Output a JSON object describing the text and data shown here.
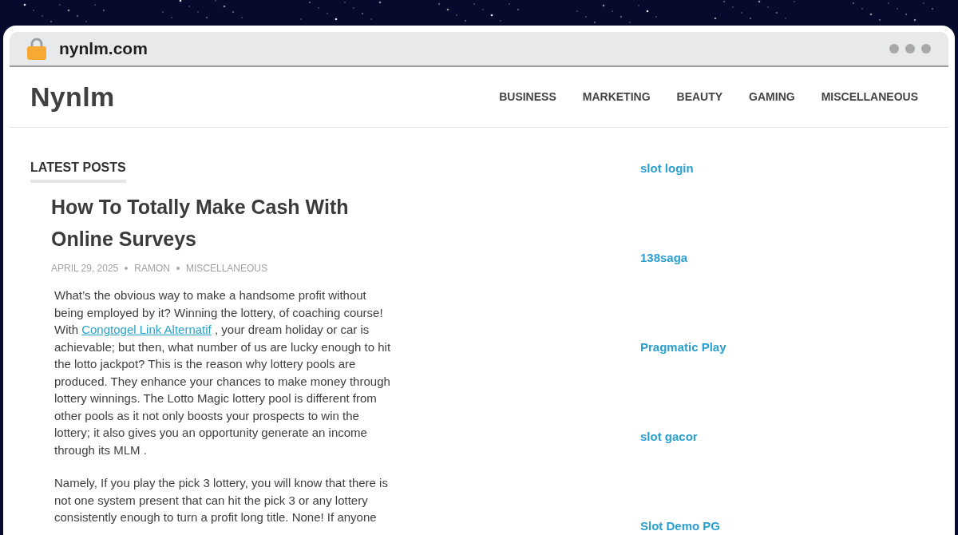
{
  "browser": {
    "url": "nynlm.com"
  },
  "site": {
    "title": "Nynlm",
    "nav": [
      "BUSINESS",
      "MARKETING",
      "BEAUTY",
      "GAMING",
      "MISCELLANEOUS"
    ]
  },
  "main": {
    "section_heading": "LATEST POSTS",
    "post": {
      "title": "How To Totally Make Cash With Online Surveys",
      "meta": [
        "APRIL 29, 2025",
        "RAMON",
        "MISCELLANEOUS"
      ],
      "paragraphs": [
        {
          "segments": [
            {
              "kind": "text",
              "text": "What’s the obvious way to make a handsome profit without being employed by it? Winning the lottery, of coaching course! With "
            },
            {
              "kind": "link",
              "text": "Congtogel Link Alternatif"
            },
            {
              "kind": "text",
              "text": " , your dream holiday or car is achievable; but then, what number of us are lucky enough to hit the lotto jackpot? This is the reason why lottery pools are produced. They enhance your chances to make money through lottery winnings. The Lotto Magic lottery pool is different from other pools as it not only boosts your prospects to win the lottery; it also gives you an opportunity generate an income through its MLM ."
            }
          ]
        },
        {
          "segments": [
            {
              "kind": "text",
              "text": "Namely, If you play the pick 3 lottery, you will know that there is not one system present that can hit the pick 3 or any lottery consistently enough to turn a profit long title. None! If anyone"
            }
          ]
        }
      ]
    }
  },
  "sidebar": {
    "links": [
      "slot login",
      "138saga",
      "Pragmatic Play",
      "slot gacor",
      "Slot Demo PG"
    ]
  }
}
